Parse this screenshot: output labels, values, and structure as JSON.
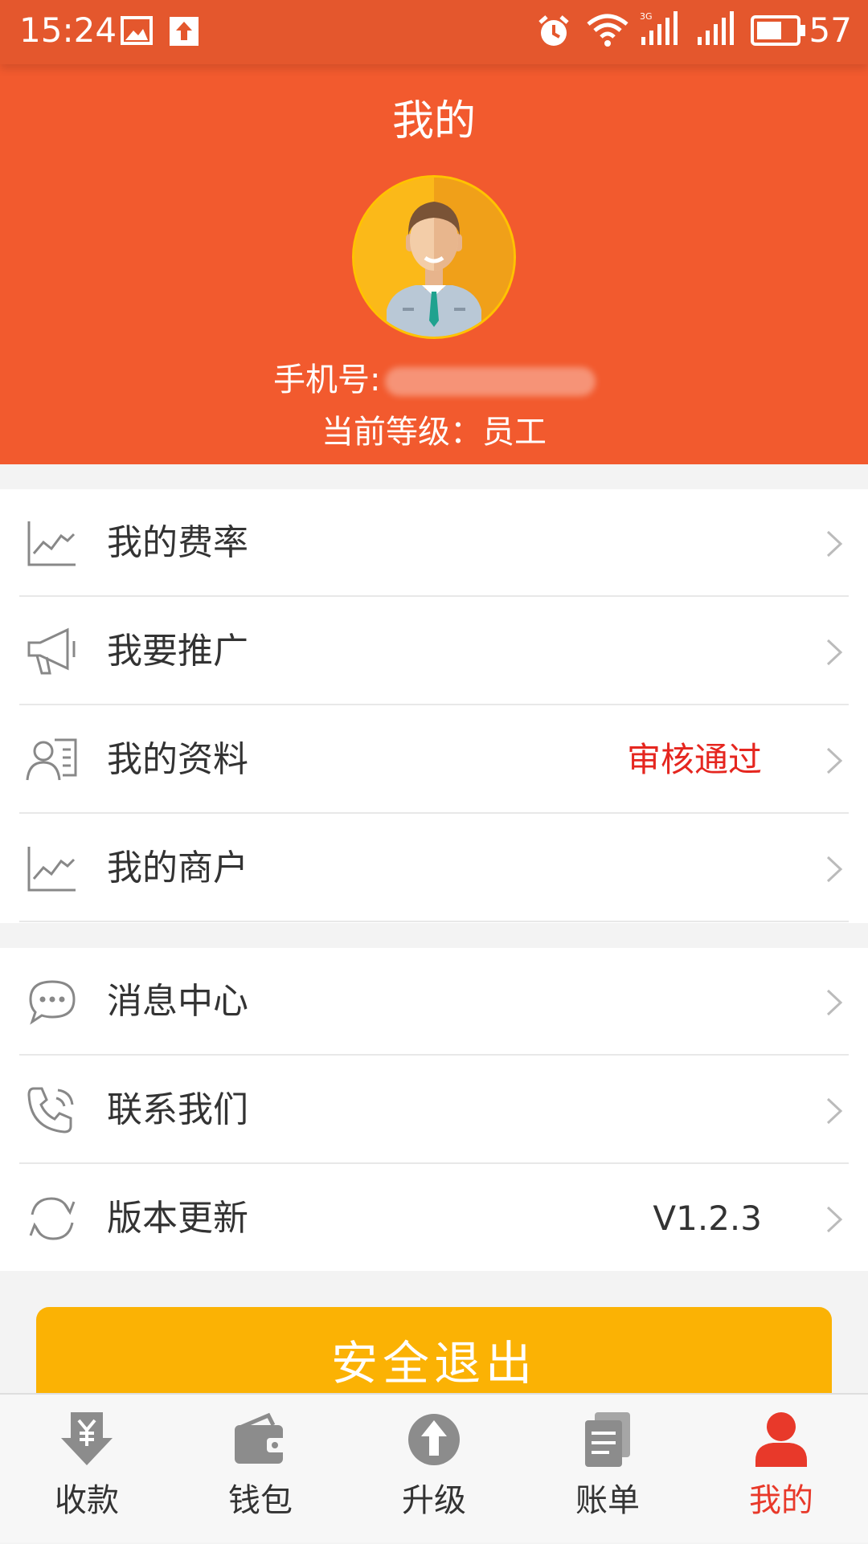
{
  "status_bar": {
    "time": "15:24",
    "battery_level": "57",
    "network_label": "3G",
    "icons": [
      "image-icon",
      "upload-icon",
      "alarm-icon",
      "wifi-icon",
      "signal-3g-icon",
      "signal-icon",
      "battery-icon"
    ]
  },
  "header": {
    "title": "我的",
    "phone_label": "手机号:",
    "level_text": "当前等级：员工"
  },
  "menu_group_1": [
    {
      "label": "我的费率",
      "value": "",
      "icon": "chart-line-icon"
    },
    {
      "label": "我要推广",
      "value": "",
      "icon": "megaphone-icon"
    },
    {
      "label": "我的资料",
      "value": "审核通过",
      "icon": "profile-card-icon"
    },
    {
      "label": "我的商户",
      "value": "",
      "icon": "chart-line-icon"
    }
  ],
  "menu_group_2": [
    {
      "label": "消息中心",
      "value": "",
      "icon": "chat-bubble-icon"
    },
    {
      "label": "联系我们",
      "value": "",
      "icon": "phone-icon"
    },
    {
      "label": "版本更新",
      "value": "V1.2.3",
      "icon": "refresh-icon"
    }
  ],
  "logout": {
    "label": "安全退出"
  },
  "tab_bar": {
    "active_index": 4,
    "tabs": [
      {
        "label": "收款",
        "icon": "receive-money-icon"
      },
      {
        "label": "钱包",
        "icon": "wallet-icon"
      },
      {
        "label": "升级",
        "icon": "upgrade-icon"
      },
      {
        "label": "账单",
        "icon": "bill-icon"
      },
      {
        "label": "我的",
        "icon": "user-icon"
      }
    ]
  },
  "colors": {
    "header": "#f25a2e",
    "status_bar": "#e4572d",
    "status_approved": "#e5261f",
    "logout_button": "#fbb204",
    "tab_active": "#e8392a",
    "tab_inactive_icon": "#8c8c8c"
  }
}
